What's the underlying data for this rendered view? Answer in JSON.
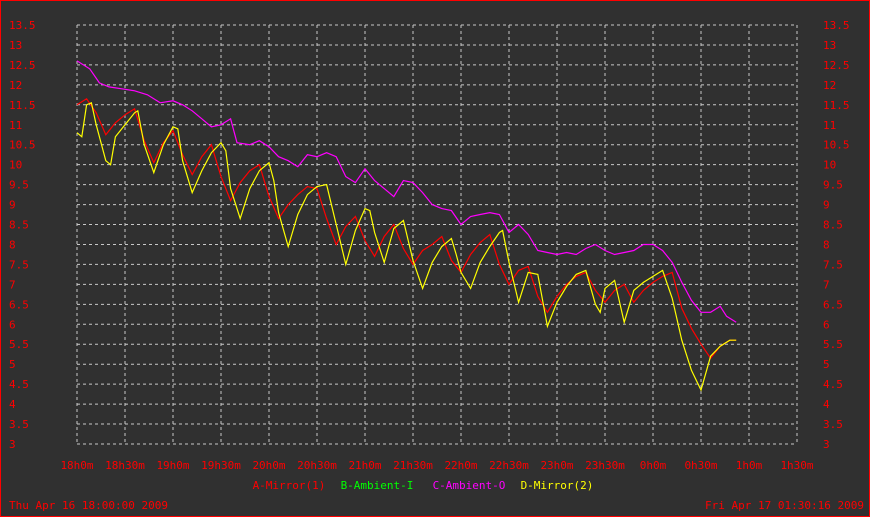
{
  "colors": {
    "background": "#303030",
    "grid": "#c8c8c8",
    "text": "#ff0000",
    "border": "#ff0000"
  },
  "footer": {
    "start_time": "Thu Apr 16 18:00:00 2009",
    "end_time": "Fri Apr 17 01:30:16 2009"
  },
  "chart_data": {
    "type": "line",
    "title": "",
    "xlabel": "",
    "ylabel": "",
    "xlim": [
      0,
      450
    ],
    "ylim": [
      3,
      13.5
    ],
    "grid": true,
    "legend_position": "bottom-center",
    "x_ticks": [
      {
        "t": 0,
        "label": "18h0m"
      },
      {
        "t": 30,
        "label": "18h30m"
      },
      {
        "t": 60,
        "label": "19h0m"
      },
      {
        "t": 90,
        "label": "19h30m"
      },
      {
        "t": 120,
        "label": "20h0m"
      },
      {
        "t": 150,
        "label": "20h30m"
      },
      {
        "t": 180,
        "label": "21h0m"
      },
      {
        "t": 210,
        "label": "21h30m"
      },
      {
        "t": 240,
        "label": "22h0m"
      },
      {
        "t": 270,
        "label": "22h30m"
      },
      {
        "t": 300,
        "label": "23h0m"
      },
      {
        "t": 330,
        "label": "23h30m"
      },
      {
        "t": 360,
        "label": "0h0m"
      },
      {
        "t": 390,
        "label": "0h30m"
      },
      {
        "t": 420,
        "label": "1h0m"
      },
      {
        "t": 450,
        "label": "1h30m"
      }
    ],
    "y_ticks": [
      "3",
      "3.5",
      "4",
      "4.5",
      "5",
      "5.5",
      "6",
      "6.5",
      "7",
      "7.5",
      "8",
      "8.5",
      "9",
      "9.5",
      "10",
      "10.5",
      "11",
      "11.5",
      "12",
      "12.5",
      "13",
      "13.5"
    ],
    "series": [
      {
        "name": "A-Mirror(1)",
        "color": "#ff0000",
        "points": [
          [
            0,
            11.5
          ],
          [
            6,
            11.65
          ],
          [
            12,
            11.3
          ],
          [
            18,
            10.75
          ],
          [
            24,
            11.05
          ],
          [
            30,
            11.25
          ],
          [
            36,
            11.4
          ],
          [
            42,
            10.6
          ],
          [
            48,
            10.05
          ],
          [
            54,
            10.55
          ],
          [
            60,
            10.85
          ],
          [
            66,
            10.25
          ],
          [
            72,
            9.75
          ],
          [
            78,
            10.2
          ],
          [
            84,
            10.5
          ],
          [
            90,
            9.7
          ],
          [
            96,
            9.1
          ],
          [
            102,
            9.55
          ],
          [
            108,
            9.85
          ],
          [
            114,
            10.0
          ],
          [
            120,
            9.2
          ],
          [
            126,
            8.65
          ],
          [
            132,
            9.0
          ],
          [
            138,
            9.25
          ],
          [
            144,
            9.45
          ],
          [
            150,
            9.4
          ],
          [
            156,
            8.65
          ],
          [
            162,
            8.0
          ],
          [
            168,
            8.45
          ],
          [
            174,
            8.7
          ],
          [
            180,
            8.1
          ],
          [
            186,
            7.7
          ],
          [
            192,
            8.2
          ],
          [
            198,
            8.5
          ],
          [
            204,
            7.9
          ],
          [
            210,
            7.5
          ],
          [
            216,
            7.85
          ],
          [
            222,
            8.0
          ],
          [
            228,
            8.2
          ],
          [
            234,
            7.6
          ],
          [
            240,
            7.3
          ],
          [
            246,
            7.75
          ],
          [
            252,
            8.05
          ],
          [
            258,
            8.25
          ],
          [
            264,
            7.5
          ],
          [
            270,
            7.0
          ],
          [
            276,
            7.35
          ],
          [
            282,
            7.45
          ],
          [
            288,
            6.7
          ],
          [
            294,
            6.3
          ],
          [
            300,
            6.7
          ],
          [
            306,
            7.0
          ],
          [
            312,
            7.2
          ],
          [
            318,
            7.3
          ],
          [
            324,
            6.85
          ],
          [
            330,
            6.55
          ],
          [
            336,
            6.85
          ],
          [
            342,
            7.0
          ],
          [
            348,
            6.55
          ],
          [
            354,
            6.85
          ],
          [
            360,
            7.05
          ],
          [
            366,
            7.2
          ],
          [
            372,
            7.3
          ],
          [
            378,
            6.4
          ],
          [
            384,
            5.9
          ],
          [
            390,
            5.5
          ],
          [
            396,
            5.15
          ],
          [
            402,
            5.45
          ],
          [
            408,
            5.6
          ],
          [
            412,
            5.6
          ]
        ]
      },
      {
        "name": "B-Ambient-I",
        "color": "#00ff00",
        "points": []
      },
      {
        "name": "C-Ambient-O",
        "color": "#ff00ff",
        "points": [
          [
            0,
            12.6
          ],
          [
            8,
            12.4
          ],
          [
            14,
            12.05
          ],
          [
            20,
            11.95
          ],
          [
            28,
            11.9
          ],
          [
            36,
            11.85
          ],
          [
            44,
            11.75
          ],
          [
            52,
            11.55
          ],
          [
            60,
            11.6
          ],
          [
            66,
            11.5
          ],
          [
            72,
            11.35
          ],
          [
            78,
            11.15
          ],
          [
            84,
            10.95
          ],
          [
            90,
            11.0
          ],
          [
            96,
            11.15
          ],
          [
            100,
            10.55
          ],
          [
            108,
            10.5
          ],
          [
            114,
            10.6
          ],
          [
            120,
            10.45
          ],
          [
            126,
            10.2
          ],
          [
            132,
            10.1
          ],
          [
            138,
            9.95
          ],
          [
            144,
            10.25
          ],
          [
            150,
            10.2
          ],
          [
            156,
            10.3
          ],
          [
            162,
            10.2
          ],
          [
            168,
            9.7
          ],
          [
            174,
            9.55
          ],
          [
            180,
            9.9
          ],
          [
            186,
            9.6
          ],
          [
            192,
            9.4
          ],
          [
            198,
            9.2
          ],
          [
            204,
            9.6
          ],
          [
            210,
            9.55
          ],
          [
            216,
            9.3
          ],
          [
            222,
            9.0
          ],
          [
            228,
            8.9
          ],
          [
            234,
            8.85
          ],
          [
            240,
            8.5
          ],
          [
            246,
            8.7
          ],
          [
            252,
            8.75
          ],
          [
            258,
            8.8
          ],
          [
            264,
            8.75
          ],
          [
            270,
            8.3
          ],
          [
            276,
            8.5
          ],
          [
            282,
            8.25
          ],
          [
            288,
            7.85
          ],
          [
            294,
            7.8
          ],
          [
            300,
            7.75
          ],
          [
            306,
            7.8
          ],
          [
            312,
            7.75
          ],
          [
            318,
            7.9
          ],
          [
            324,
            8.0
          ],
          [
            330,
            7.85
          ],
          [
            336,
            7.75
          ],
          [
            342,
            7.8
          ],
          [
            348,
            7.85
          ],
          [
            354,
            8.0
          ],
          [
            360,
            8.0
          ],
          [
            366,
            7.85
          ],
          [
            372,
            7.55
          ],
          [
            378,
            7.05
          ],
          [
            384,
            6.6
          ],
          [
            390,
            6.3
          ],
          [
            396,
            6.3
          ],
          [
            402,
            6.45
          ],
          [
            406,
            6.2
          ],
          [
            412,
            6.05
          ]
        ]
      },
      {
        "name": "D-Mirror(2)",
        "color": "#ffff00",
        "points": [
          [
            0,
            10.8
          ],
          [
            3,
            10.7
          ],
          [
            6,
            11.5
          ],
          [
            9,
            11.55
          ],
          [
            12,
            11.0
          ],
          [
            18,
            10.1
          ],
          [
            21,
            10.0
          ],
          [
            24,
            10.7
          ],
          [
            30,
            11.0
          ],
          [
            36,
            11.3
          ],
          [
            38,
            11.35
          ],
          [
            42,
            10.5
          ],
          [
            48,
            9.8
          ],
          [
            54,
            10.5
          ],
          [
            60,
            10.95
          ],
          [
            63,
            10.9
          ],
          [
            66,
            10.1
          ],
          [
            72,
            9.3
          ],
          [
            78,
            9.85
          ],
          [
            84,
            10.3
          ],
          [
            90,
            10.55
          ],
          [
            93,
            10.35
          ],
          [
            96,
            9.4
          ],
          [
            102,
            8.65
          ],
          [
            108,
            9.4
          ],
          [
            114,
            9.85
          ],
          [
            120,
            10.05
          ],
          [
            123,
            9.6
          ],
          [
            126,
            8.8
          ],
          [
            132,
            7.95
          ],
          [
            138,
            8.75
          ],
          [
            144,
            9.25
          ],
          [
            150,
            9.45
          ],
          [
            156,
            9.5
          ],
          [
            162,
            8.5
          ],
          [
            168,
            7.5
          ],
          [
            174,
            8.35
          ],
          [
            180,
            8.9
          ],
          [
            183,
            8.85
          ],
          [
            186,
            8.3
          ],
          [
            192,
            7.55
          ],
          [
            198,
            8.4
          ],
          [
            204,
            8.6
          ],
          [
            210,
            7.6
          ],
          [
            216,
            6.9
          ],
          [
            222,
            7.55
          ],
          [
            228,
            7.95
          ],
          [
            234,
            8.15
          ],
          [
            237,
            7.75
          ],
          [
            240,
            7.3
          ],
          [
            246,
            6.9
          ],
          [
            252,
            7.55
          ],
          [
            258,
            7.95
          ],
          [
            264,
            8.3
          ],
          [
            266,
            8.35
          ],
          [
            270,
            7.55
          ],
          [
            276,
            6.55
          ],
          [
            282,
            7.3
          ],
          [
            288,
            7.25
          ],
          [
            291,
            6.6
          ],
          [
            294,
            5.95
          ],
          [
            300,
            6.55
          ],
          [
            306,
            6.95
          ],
          [
            312,
            7.25
          ],
          [
            318,
            7.35
          ],
          [
            324,
            6.5
          ],
          [
            327,
            6.3
          ],
          [
            330,
            6.9
          ],
          [
            336,
            7.1
          ],
          [
            342,
            6.05
          ],
          [
            348,
            6.85
          ],
          [
            354,
            7.05
          ],
          [
            360,
            7.2
          ],
          [
            366,
            7.35
          ],
          [
            372,
            6.65
          ],
          [
            378,
            5.6
          ],
          [
            384,
            4.85
          ],
          [
            390,
            4.35
          ],
          [
            396,
            5.2
          ],
          [
            402,
            5.45
          ],
          [
            408,
            5.6
          ],
          [
            412,
            5.6
          ]
        ]
      }
    ]
  }
}
